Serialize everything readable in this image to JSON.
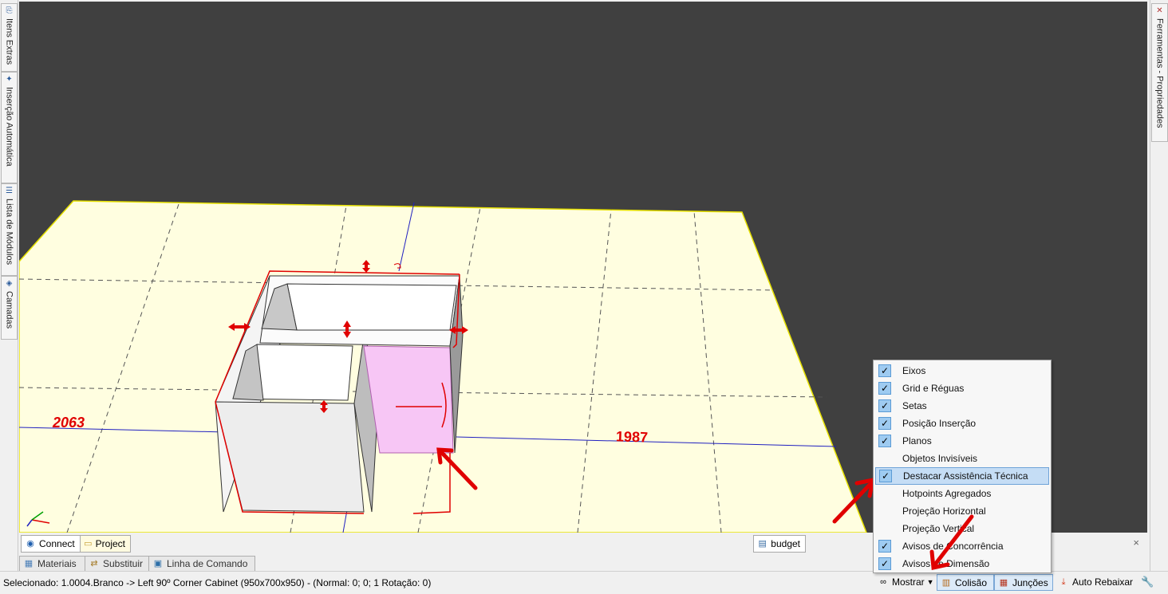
{
  "left_tabs": [
    {
      "label": "Itens Extras",
      "icon": "paperclip-icon"
    },
    {
      "label": "Inserção Automática",
      "icon": "wand-icon"
    },
    {
      "label": "Lista de Módulos",
      "icon": "list-icon"
    },
    {
      "label": "Camadas",
      "icon": "layers-icon"
    }
  ],
  "right_tabs": [
    {
      "label": "Ferramentas - Propriedades",
      "icon": "tools-icon"
    }
  ],
  "viewport": {
    "dimension_left": "2063",
    "dimension_right": "1987",
    "floor_color": "#fffee0",
    "background_color": "#404040",
    "highlight_color": "#f7c6f5",
    "accent_color": "#e00000"
  },
  "bottom_tabs": [
    {
      "label": "Connect",
      "icon": "rss-icon"
    },
    {
      "label": "Project",
      "icon": "folder-icon"
    },
    {
      "label": "budget",
      "icon": "budget-icon"
    }
  ],
  "close_label": "×",
  "doc_tabs": [
    {
      "label": "Materiais",
      "icon": "materials-icon"
    },
    {
      "label": "Substituir",
      "icon": "replace-icon"
    },
    {
      "label": "Linha de Comando",
      "icon": "terminal-icon"
    }
  ],
  "status": {
    "text": "Selecionado: 1.0004.Branco -> Left 90º Corner Cabinet (950x700x950) - (Normal: 0; 0; 1 Rotação: 0)"
  },
  "status_buttons": {
    "mostrar": "Mostrar",
    "colisao": "Colisão",
    "juncoes": "Junções",
    "auto_rebaixar": "Auto Rebaixar"
  },
  "menu": {
    "items": [
      {
        "label": "Eixos",
        "checked": true
      },
      {
        "label": "Grid e Réguas",
        "checked": true
      },
      {
        "label": "Setas",
        "checked": true
      },
      {
        "label": "Posição Inserção",
        "checked": true
      },
      {
        "label": "Planos",
        "checked": true
      },
      {
        "label": "Objetos Invisíveis",
        "checked": false
      },
      {
        "label": "Destacar Assistência Técnica",
        "checked": true,
        "highlighted": true
      },
      {
        "label": "Hotpoints Agregados",
        "checked": false
      },
      {
        "label": "Projeção Horizontal",
        "checked": false
      },
      {
        "label": "Projeção Vertical",
        "checked": false
      },
      {
        "label": "Avisos de Concorrência",
        "checked": true
      },
      {
        "label": "Avisos de Dimensão",
        "checked": true
      }
    ]
  }
}
